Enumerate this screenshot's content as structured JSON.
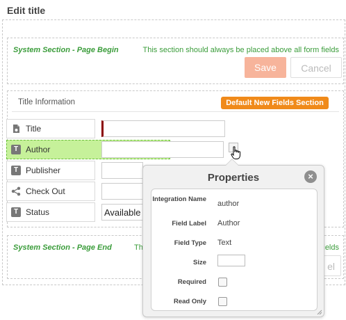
{
  "page": {
    "title": "Edit title"
  },
  "system_begin": {
    "title": "System Section - Page Begin",
    "note": "This section should always be placed above all form fields",
    "save_label": "Save",
    "cancel_label": "Cancel"
  },
  "fields_section": {
    "heading": "Title Information",
    "badge": "Default New Fields Section",
    "fields": [
      {
        "label": "Title",
        "icon": "document-icon",
        "value": ""
      },
      {
        "label": "Author",
        "icon": "text-type-icon",
        "value": ""
      },
      {
        "label": "Publisher",
        "icon": "text-type-icon",
        "value": ""
      },
      {
        "label": "Check Out",
        "icon": "share-icon",
        "value": ""
      },
      {
        "label": "Status",
        "icon": "text-type-icon",
        "value": "Available"
      }
    ],
    "text_icon_glyph": "T"
  },
  "system_end": {
    "title": "System Section - Page End",
    "note_prefix": "Th",
    "note_suffix": "fields",
    "cancel_partial": "el"
  },
  "properties": {
    "title": "Properties",
    "close_glyph": "×",
    "integration_name_label": "Integration Name",
    "integration_name_value": "author",
    "field_label_label": "Field Label",
    "field_label_value": "Author",
    "field_type_label": "Field Type",
    "field_type_value": "Text",
    "size_label": "Size",
    "required_label": "Required",
    "read_only_label": "Read Only"
  },
  "colors": {
    "accent_green": "#3a9c3a",
    "save_button": "#f7b49b",
    "badge_orange": "#f08a1a",
    "selected_row": "#c6f19a",
    "required_marker": "#8b0000"
  }
}
